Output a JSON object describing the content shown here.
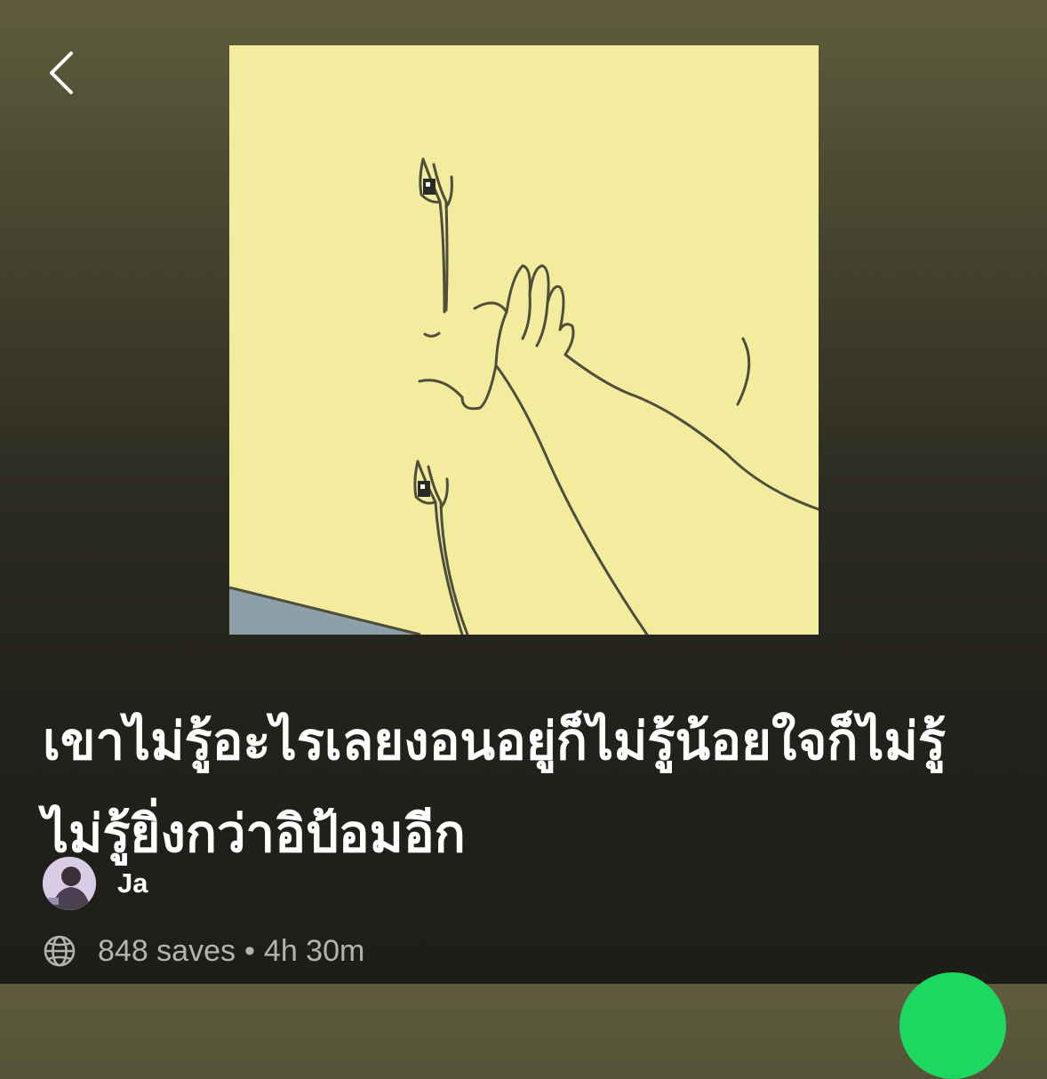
{
  "header": {
    "back_icon": "chevron-left-icon"
  },
  "cover": {
    "description_icon": "cover-art"
  },
  "playlist": {
    "title": "เขาไม่รู้อะไรเลยงอนอยู่ก็ไม่รู้น้อยใจก็ไม่รู้ไม่รู้ยิ่งกว่าอิป้อมอีก",
    "owner": "Ja",
    "saves": "848 saves",
    "separator": "•",
    "duration": "4h 30m",
    "visibility_icon": "globe-icon"
  },
  "colors": {
    "accent": "#1ed760",
    "cover_background": "#f3ec9f",
    "secondary_text": "#b3b3b3"
  }
}
